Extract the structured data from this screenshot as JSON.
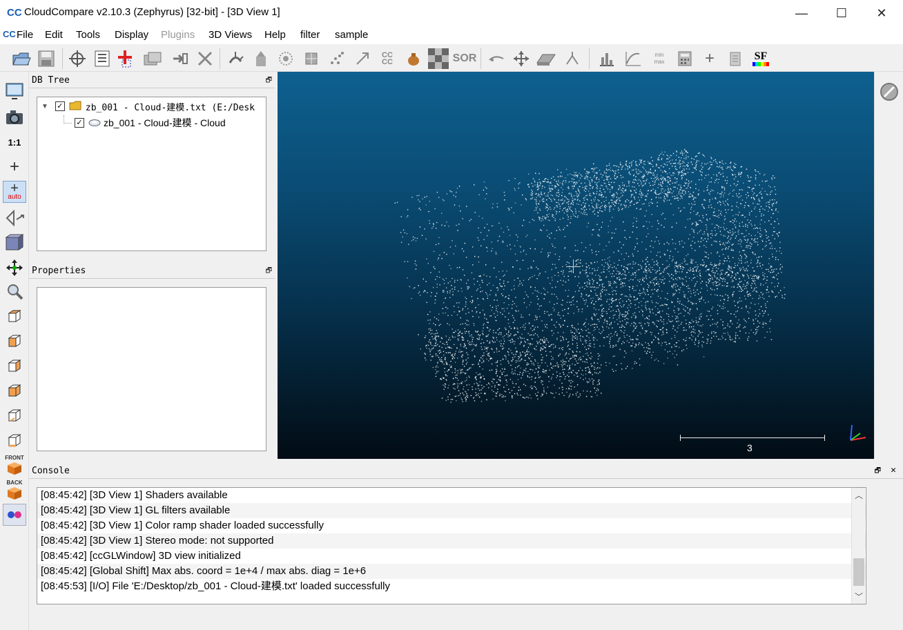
{
  "window": {
    "title": "CloudCompare v2.10.3 (Zephyrus) [32-bit] - [3D View 1]",
    "minimize": "—",
    "maximize": "☐",
    "close": "✕"
  },
  "menubar": {
    "items": [
      {
        "label": "File",
        "enabled": true
      },
      {
        "label": "Edit",
        "enabled": true
      },
      {
        "label": "Tools",
        "enabled": true
      },
      {
        "label": "Display",
        "enabled": true
      },
      {
        "label": "Plugins",
        "enabled": false
      },
      {
        "label": "3D Views",
        "enabled": true
      },
      {
        "label": "Help",
        "enabled": true
      },
      {
        "label": "filter",
        "enabled": true
      },
      {
        "label": "sample",
        "enabled": true
      }
    ],
    "mdi": [
      "–",
      "▫",
      "✕"
    ]
  },
  "toolbar": {
    "icons": [
      "open-icon",
      "save-icon",
      "pick-rotation-center-icon",
      "list-icon",
      "add-point-icon",
      "clone-icon",
      "merge-icon",
      "delete-icon",
      "normals-icon",
      "cross-section-icon",
      "subsample-icon",
      "density-icon",
      "noise-icon",
      "registration-icon",
      "cc-icon",
      "pot-icon",
      "checkerboard-icon",
      "sor-icon",
      "segment-icon",
      "translate-rotate-icon",
      "plane-icon",
      "measure-icon",
      "histogram-icon",
      "curve-icon",
      "minmax-icon",
      "calculator-icon",
      "plus-icon",
      "clipboard-icon",
      "scalar-field-icon"
    ],
    "sor_label": "SOR",
    "sf_label": "SF",
    "cc_label": "CC",
    "minmax_top": "min",
    "minmax_bottom": "max"
  },
  "left_toolbar": {
    "one_to_one": "1:1",
    "auto_label": "auto",
    "front_label": "FRONT",
    "back_label": "BACK"
  },
  "db_tree": {
    "header": "DB Tree",
    "items": [
      {
        "label": "zb_001 - Cloud-建模.txt (E:/Desk",
        "checked": true
      },
      {
        "label": "zb_001 - Cloud-建模 - Cloud",
        "checked": true
      }
    ]
  },
  "properties": {
    "header": "Properties"
  },
  "view3d": {
    "scale_label": "3"
  },
  "console": {
    "header": "Console",
    "lines": [
      "[08:45:42] [3D View 1] Shaders available",
      "[08:45:42] [3D View 1] GL filters available",
      "[08:45:42] [3D View 1] Color ramp shader loaded successfully",
      "[08:45:42] [3D View 1] Stereo mode: not supported",
      "[08:45:42] [ccGLWindow] 3D view initialized",
      "[08:45:42] [Global Shift] Max abs. coord = 1e+4 / max abs. diag = 1e+6",
      "[08:45:53] [I/O] File 'E:/Desktop/zb_001 - Cloud-建模.txt' loaded successfully"
    ]
  }
}
